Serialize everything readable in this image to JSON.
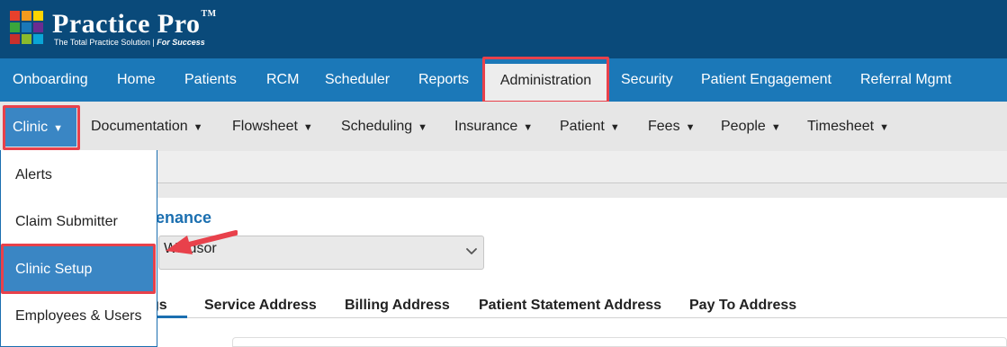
{
  "logo": {
    "title": "Practice Pro",
    "trademark": "TM",
    "tagline_main": "The Total Practice Solution | ",
    "tagline_em": "For Success",
    "colors": [
      "#e8412c",
      "#f39a1e",
      "#ffd400",
      "#3aa63c",
      "#1b78b8",
      "#6b2c91",
      "#c9302c",
      "#8aba2c",
      "#0aa5d6"
    ]
  },
  "main_nav": {
    "items": [
      "Onboarding",
      "Home",
      "Patients",
      "RCM",
      "Scheduler",
      "Reports",
      "Administration",
      "Security",
      "Patient Engagement",
      "Referral Mgmt"
    ],
    "active": "Administration"
  },
  "sub_nav": {
    "clinic": "Clinic",
    "items": [
      "Documentation",
      "Flowsheet",
      "Scheduling",
      "Insurance",
      "Patient",
      "Fees",
      "People",
      "Timesheet"
    ],
    "caret": "▼"
  },
  "dropdown": {
    "items": [
      "Alerts",
      "Claim Submitter",
      "Clinic Setup",
      "Employees & Users"
    ],
    "selected": "Clinic Setup"
  },
  "content": {
    "title": "enance",
    "select_value": "Windsor",
    "tabs": [
      "gs",
      "Service Address",
      "Billing Address",
      "Patient Statement Address",
      "Pay To Address"
    ]
  },
  "colors": {
    "header": "#0a4a7a",
    "nav": "#1b78b8",
    "accent": "#3a86c4",
    "highlight": "#e8414b"
  }
}
